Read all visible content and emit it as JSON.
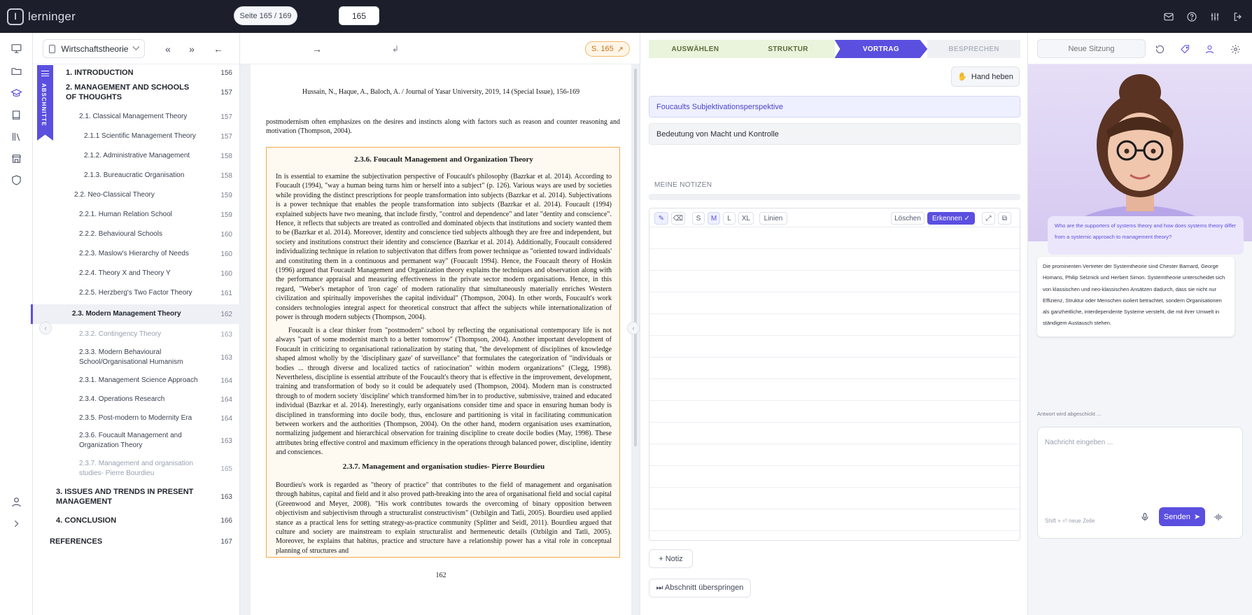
{
  "app": {
    "name": "lerninger",
    "logo_letter": "l"
  },
  "topbar_icons": [
    "mail-icon",
    "help-icon",
    "sliders-icon",
    "logout-icon"
  ],
  "rail_icons": [
    "presentation-icon",
    "folder-icon",
    "graduation-cap-icon",
    "book-icon",
    "library-icon",
    "store-icon",
    "shield-icon",
    "user-icon",
    "expand-icon"
  ],
  "toc": {
    "book_select": "Wirtschaftstheorie",
    "first_btn": "«",
    "prev_btn": "»",
    "tab_label": "ABSCHNITTE",
    "items": [
      {
        "title": "1. INTRODUCTION",
        "page": "156"
      },
      {
        "title": "2. MANAGEMENT AND SCHOOLS OF THOUGHTS",
        "page": "157"
      },
      {
        "title": "2.1. Classical Management Theory",
        "page": "157"
      },
      {
        "title": "2.1.1 Scientific Management Theory",
        "page": "157"
      },
      {
        "title": "2.1.2. Administrative Management",
        "page": "158"
      },
      {
        "title": "2.1.3. Bureaucratic Organisation",
        "page": "158"
      },
      {
        "title": "2.2. Neo-Classical Theory",
        "page": "159"
      },
      {
        "title": "2.2.1. Human Relation School",
        "page": "159"
      },
      {
        "title": "2.2.2. Behavioural Schools",
        "page": "160"
      },
      {
        "title": "2.2.3. Maslow's Hierarchy of Needs",
        "page": "160"
      },
      {
        "title": "2.2.4. Theory X and Theory Y",
        "page": "160"
      },
      {
        "title": "2.2.5. Herzberg's Two Factor Theory",
        "page": "161"
      },
      {
        "title": "2.3. Modern Management Theory",
        "page": "162"
      },
      {
        "title": "2.3.2. Contingency Theory",
        "page": "163"
      },
      {
        "title": "2.3.3. Modern Behavioural School/Organisational Humanism",
        "page": "163"
      },
      {
        "title": "2.3.1. Management Science Approach",
        "page": "164"
      },
      {
        "title": "2.3.4. Operations Research",
        "page": "164"
      },
      {
        "title": "2.3.5. Post-modern to Modernity Era",
        "page": "164"
      },
      {
        "title": "2.3.6. Foucault Management and Organization Theory",
        "page": "163"
      },
      {
        "title": "2.3.7. Management and organisation studies- Pierre Bourdieu",
        "page": "165"
      },
      {
        "title": "3. ISSUES AND TRENDS IN PRESENT MANAGEMENT",
        "page": "163"
      },
      {
        "title": "4. CONCLUSION",
        "page": "166"
      },
      {
        "title": "REFERENCES",
        "page": "167"
      }
    ]
  },
  "doc_toolbar": {
    "back_arrow": "←",
    "page_label": "Seite 165 / 169",
    "fwd_arrow": "→",
    "page_input": "165",
    "return_glyph": "↲",
    "page_badge": "S. 165"
  },
  "paper": {
    "header": "Hussain, N., Haque, A., Baloch, A. / Journal of Yasar University, 2019, 14 (Special Issue), 156-169",
    "intro": "postmodernism often emphasizes on the desires and instincts along with factors such as reason and counter reasoning and motivation (Thompson, 2004).",
    "section_236": "2.3.6. Foucault Management and Organization Theory",
    "para1": "In is essential to examine the subjectivation perspective of Foucault's philosophy (Bazrkar et al. 2014). According to Foucault (1994), \"way a human being turns him or herself into a subject\" (p. 126). Various ways are used by societies while providing the distinct prescriptions for people transformation into subjects (Bazrkar et al. 2014). Subjectivations is a power technique that enables the people transformation into subjects (Bazrkar et al. 2014). Foucault (1994) explained subjects have two meaning, that include firstly, \"control and dependence\" and later \"dentity and conscience\". Hence, it reflects that subjects are treated as controlled and dominated objects that institutions and society wanted them to be (Bazrkar et al. 2014). Moreover, identity and conscience tied subjects although they are free and independent, but society and institutions construct their identity and conscience (Bazrkar et al. 2014). Additionally, Foucault considered individualizing technique in relation to subjectivaton that differs from power technique as \"oriented toward individuals' and constituting them in a continuous and permanent way\" (Foucault 1994). Hence, the Foucault theory of Hoskin (1996) argued that Foucault Management and Organization theory explains the techniques and observation along with the performance appraisal and measuring effectiveness in the private sector modern organisations. Hence, in this regard, \"Weber's metaphor of 'iron cage' of modern rationality that simultaneously materially enriches Western civilization and spiritually impoverishes the capital individual\" (Thompson, 2004). In other words, Foucault's work considers technologies integral aspect for theoretical construct that affect the subjects while internationalization of power is through modern subjects (Thompson, 2004).",
    "para2": "Foucault is a clear thinker from \"postmodern\" school by reflecting the organisational contemporary life is not always \"part of some modernist march to a better tomorrow\" (Thompson, 2004). Another important development of Foucault in criticizing to organisational rationalization by stating that, \"the development of disciplines of knowledge shaped almost wholly by the 'disciplinary gaze' of surveillance\" that formulates the categorization of \"individuals or bodies ... through diverse and localized tactics of ratiocination\" within modern organizations\" (Clegg, 1998). Nevertheless, discipline is essential attribute of the Foucault's theory that is effective in the improvement, development, training and transformation of body so it could be adequately used (Thompson, 2004). Modern man is constructed through to of modern society 'discipline' which transformed him/her in to productive, submissive, trained and educated individual (Bazrkar et al. 2014). Inerestingly, early organisations consider time and space in ensuring human body is disciplined in transforming into docile body, thus, enclosure and partitioning is vital in facilitating communication between workers and the authorities (Thompson, 2004). On the other hand, modern organisation uses examination, normalizing judgement and hierarchical observation for training discipline to create docile bodies (May, 1998). These attributes bring effective control and maximum efficiency in the operations through balanced power, discipline, identity and consciences.",
    "section_237": "2.3.7. Management and organisation studies- Pierre Bourdieu",
    "para3": "Bourdieu's work is regarded as \"theory of practice\" that contributes to the field of management and organisation through habitus, capital and field and it also proved path-breaking into the area of organisational field and social capital (Greenwood and Meyer, 2008). \"His work contributes towards the overcoming of binary opposition between objectivism and subjectivism through a structuralist constructivism\" (Ozbilgin and Tatli, 2005). Bourdieu used applied stance as a practical lens for setting strategy-as-practice community (Splitter and Seidl, 2011). Bourdieu argued that culture and society are mainstream to explain structuralist and hermeneutic details (Ozbilgin and Tatli, 2005). Moreover, he explains that habitus, practice and structure have a relationship power has a vital role in conceptual planning of structures and",
    "page_number": "162"
  },
  "steps": [
    {
      "label": "AUSWÄHLEN",
      "state": "done"
    },
    {
      "label": "STRUKTUR",
      "state": "done"
    },
    {
      "label": "VORTRAG",
      "state": "active"
    },
    {
      "label": "BESPRECHEN",
      "state": "todo"
    }
  ],
  "mid": {
    "hand_btn": "Hand heben",
    "topics": [
      "Foucaults Subjektivationsperspektive",
      "Bedeutung von Macht und Kontrolle"
    ],
    "notes_label": "MEINE NOTIZEN",
    "tools": {
      "s": "S",
      "m": "M",
      "l": "L",
      "xl": "XL",
      "lines": "Linien",
      "clear": "Löschen",
      "recognize": "Erkennen ✓"
    },
    "notiz_btn": "+ Notiz",
    "skip_btn": "⏭ Abschnitt überspringen"
  },
  "right": {
    "session_placeholder": "Neue Sitzung",
    "question": "Who are the supporters of systems theory and how does systems theory differ from a systemic approach to management theory?",
    "answer": "Die prominenten Vertreter der Systemtheorie sind Chester Barnard, George Homans, Philip Selznick und Herbert Simon. Systemtheorie unterscheidet sich von klassischen und neo-klassischen Ansätzen dadurch, dass sie nicht nur Effizienz, Struktur oder Menschen isoliert betrachtet, sondern Organisationen als ganzheitliche, interdependente Systeme versteht, die mit ihrer Umwelt in ständigem Austausch stehen.",
    "status": "Antwort wird abgeschickt ...",
    "msg_placeholder": "Nachricht eingeben ...",
    "hint": "Shift + ⏎ neue Zeile",
    "send": "Senden"
  },
  "colors": {
    "accent": "#5b4fe0",
    "topbar": "#1c1f2b",
    "highlight_border": "#f1a94c",
    "done_step": "#eaf3dc"
  }
}
